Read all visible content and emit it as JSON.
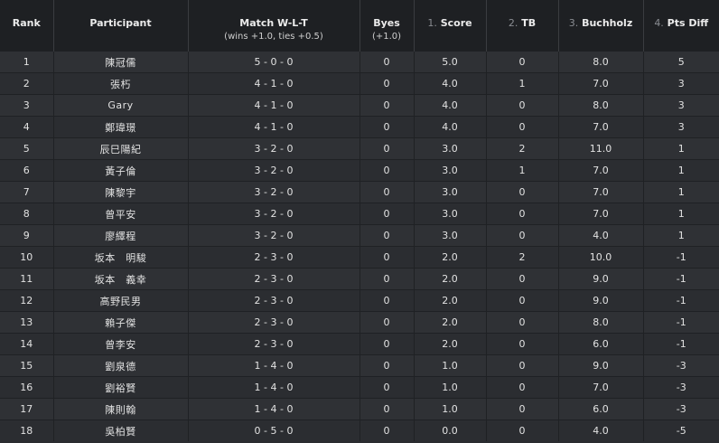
{
  "headers": {
    "rank": "Rank",
    "participant": "Participant",
    "match": "Match W-L-T",
    "match_sub": "(wins +1.0, ties +0.5)",
    "byes": "Byes",
    "byes_sub": "(+1.0)",
    "score_num": "1.",
    "score": "Score",
    "tb_num": "2.",
    "tb": "TB",
    "buchholz_num": "3.",
    "buchholz": "Buchholz",
    "ptsdiff_num": "4.",
    "ptsdiff": "Pts Diff"
  },
  "rows": [
    {
      "rank": "1",
      "name": "陳冠儒",
      "wlt": "5 - 0 - 0",
      "byes": "0",
      "score": "5.0",
      "tb": "0",
      "buchholz": "8.0",
      "diff": "5"
    },
    {
      "rank": "2",
      "name": "張朽",
      "wlt": "4 - 1 - 0",
      "byes": "0",
      "score": "4.0",
      "tb": "1",
      "buchholz": "7.0",
      "diff": "3"
    },
    {
      "rank": "3",
      "name": "Gary",
      "wlt": "4 - 1 - 0",
      "byes": "0",
      "score": "4.0",
      "tb": "0",
      "buchholz": "8.0",
      "diff": "3"
    },
    {
      "rank": "4",
      "name": "鄭瑋璟",
      "wlt": "4 - 1 - 0",
      "byes": "0",
      "score": "4.0",
      "tb": "0",
      "buchholz": "7.0",
      "diff": "3"
    },
    {
      "rank": "5",
      "name": "辰巳陽紀",
      "wlt": "3 - 2 - 0",
      "byes": "0",
      "score": "3.0",
      "tb": "2",
      "buchholz": "11.0",
      "diff": "1"
    },
    {
      "rank": "6",
      "name": "黃子倫",
      "wlt": "3 - 2 - 0",
      "byes": "0",
      "score": "3.0",
      "tb": "1",
      "buchholz": "7.0",
      "diff": "1"
    },
    {
      "rank": "7",
      "name": "陳黎宇",
      "wlt": "3 - 2 - 0",
      "byes": "0",
      "score": "3.0",
      "tb": "0",
      "buchholz": "7.0",
      "diff": "1"
    },
    {
      "rank": "8",
      "name": "曾平安",
      "wlt": "3 - 2 - 0",
      "byes": "0",
      "score": "3.0",
      "tb": "0",
      "buchholz": "7.0",
      "diff": "1"
    },
    {
      "rank": "9",
      "name": "廖繹程",
      "wlt": "3 - 2 - 0",
      "byes": "0",
      "score": "3.0",
      "tb": "0",
      "buchholz": "4.0",
      "diff": "1"
    },
    {
      "rank": "10",
      "name": "坂本　明駿",
      "wlt": "2 - 3 - 0",
      "byes": "0",
      "score": "2.0",
      "tb": "2",
      "buchholz": "10.0",
      "diff": "-1"
    },
    {
      "rank": "11",
      "name": "坂本　義幸",
      "wlt": "2 - 3 - 0",
      "byes": "0",
      "score": "2.0",
      "tb": "0",
      "buchholz": "9.0",
      "diff": "-1"
    },
    {
      "rank": "12",
      "name": "高野民男",
      "wlt": "2 - 3 - 0",
      "byes": "0",
      "score": "2.0",
      "tb": "0",
      "buchholz": "9.0",
      "diff": "-1"
    },
    {
      "rank": "13",
      "name": "賴子傑",
      "wlt": "2 - 3 - 0",
      "byes": "0",
      "score": "2.0",
      "tb": "0",
      "buchholz": "8.0",
      "diff": "-1"
    },
    {
      "rank": "14",
      "name": "曾李安",
      "wlt": "2 - 3 - 0",
      "byes": "0",
      "score": "2.0",
      "tb": "0",
      "buchholz": "6.0",
      "diff": "-1"
    },
    {
      "rank": "15",
      "name": "劉泉德",
      "wlt": "1 - 4 - 0",
      "byes": "0",
      "score": "1.0",
      "tb": "0",
      "buchholz": "9.0",
      "diff": "-3"
    },
    {
      "rank": "16",
      "name": "劉裕賢",
      "wlt": "1 - 4 - 0",
      "byes": "0",
      "score": "1.0",
      "tb": "0",
      "buchholz": "7.0",
      "diff": "-3"
    },
    {
      "rank": "17",
      "name": "陳則翰",
      "wlt": "1 - 4 - 0",
      "byes": "0",
      "score": "1.0",
      "tb": "0",
      "buchholz": "6.0",
      "diff": "-3"
    },
    {
      "rank": "18",
      "name": "吳柏賢",
      "wlt": "0 - 5 - 0",
      "byes": "0",
      "score": "0.0",
      "tb": "0",
      "buchholz": "4.0",
      "diff": "-5"
    }
  ]
}
